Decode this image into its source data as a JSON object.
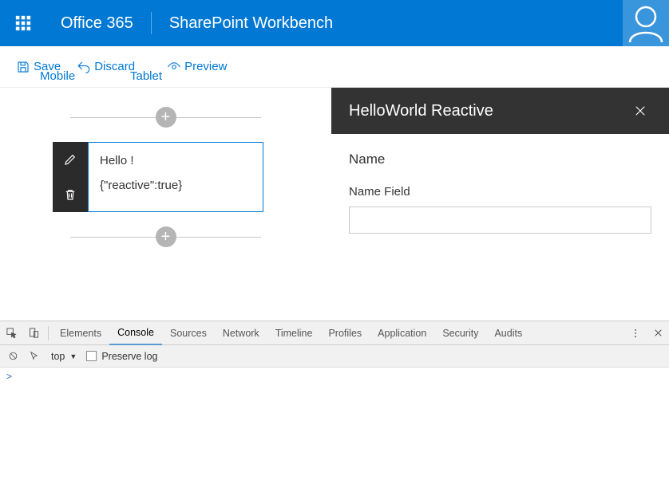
{
  "suite": {
    "brand": "Office 365",
    "app": "SharePoint Workbench"
  },
  "toolbar": {
    "save_label": "Save",
    "discard_label": "Discard",
    "preview_label": "Preview",
    "mobile_label": "Mobile",
    "tablet_label": "Tablet"
  },
  "webpart": {
    "line1": "Hello !",
    "line2": "{\"reactive\":true}"
  },
  "propPane": {
    "title": "HelloWorld Reactive",
    "sectionLabel": "Name",
    "fieldLabel": "Name Field",
    "fieldValue": ""
  },
  "devtools": {
    "tabs": [
      "Elements",
      "Console",
      "Sources",
      "Network",
      "Timeline",
      "Profiles",
      "Application",
      "Security",
      "Audits"
    ],
    "activeTab": "Console",
    "context": "top",
    "preserveLog": "Preserve log",
    "prompt": ">"
  }
}
